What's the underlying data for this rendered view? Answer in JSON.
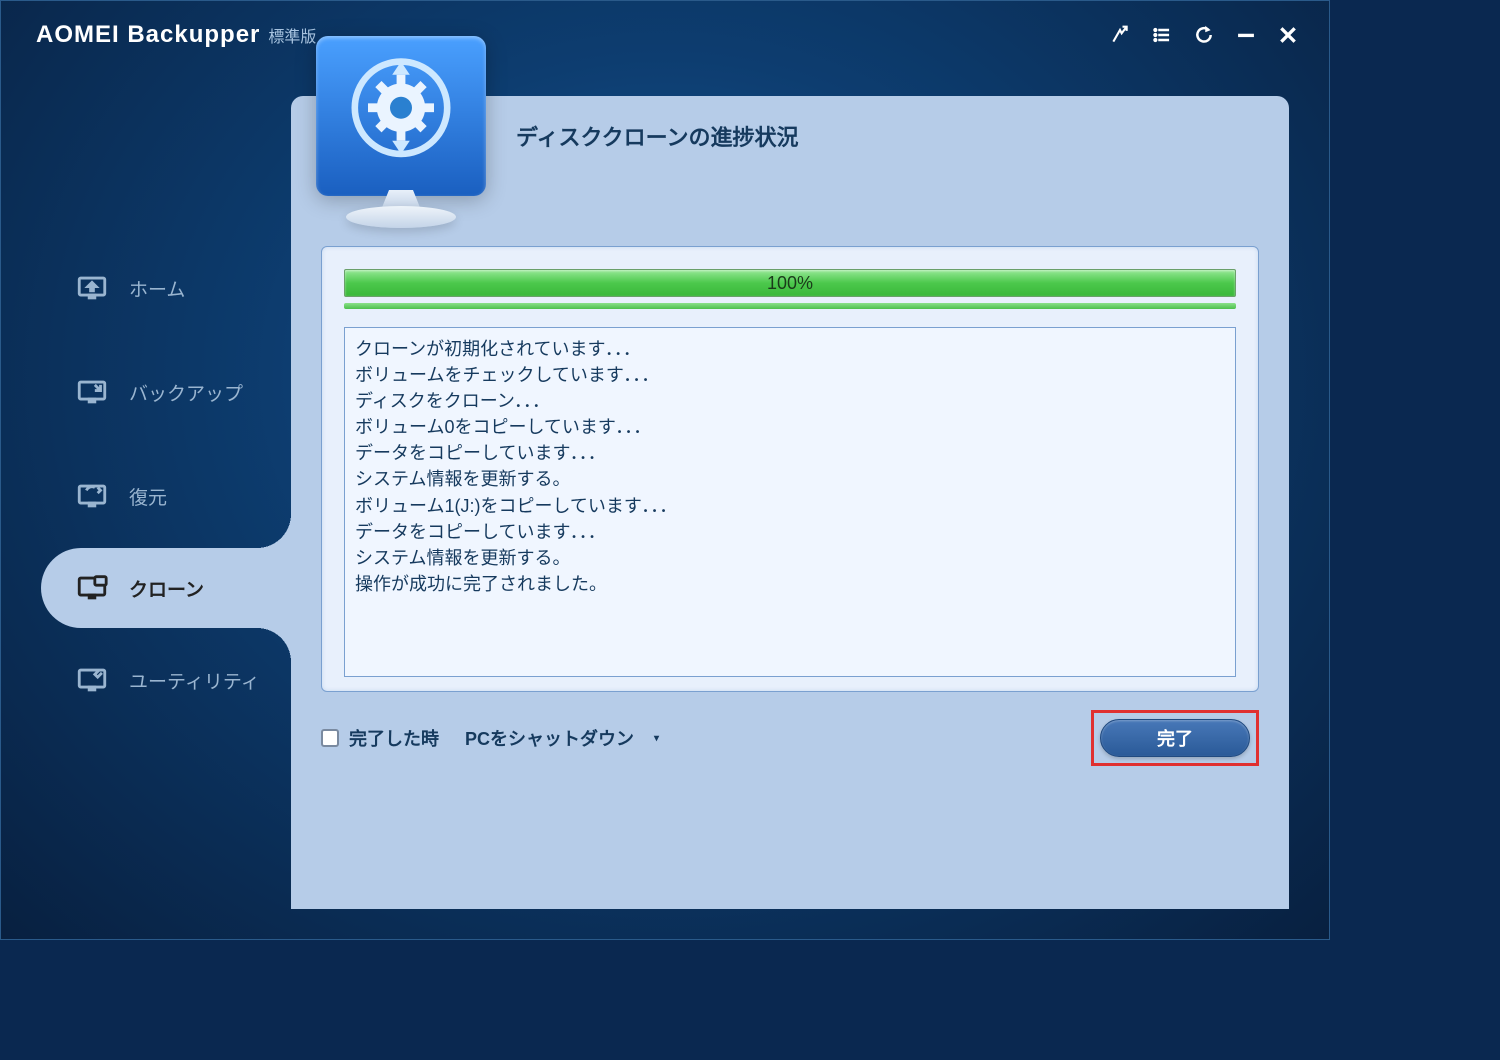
{
  "header": {
    "app_name": "AOMEI Backupper",
    "edition": "標準版"
  },
  "sidebar": {
    "items": [
      {
        "label": "ホーム"
      },
      {
        "label": "バックアップ"
      },
      {
        "label": "復元"
      },
      {
        "label": "クローン"
      },
      {
        "label": "ユーティリティ"
      }
    ]
  },
  "main": {
    "title": "ディスククローンの進捗状況",
    "progress_text": "100%",
    "log": [
      "クローンが初期化されています．．．",
      "ボリュームをチェックしています．．．",
      "ディスクをクローン．．．",
      "ボリューム0をコピーしています．．．",
      "データをコピーしています．．．",
      "システム情報を更新する。",
      "ボリューム1(J:)をコピーしています．．．",
      "データをコピーしています．．．",
      "システム情報を更新する。",
      "操作が成功に完了されました。"
    ],
    "footer": {
      "checkbox_prefix": "完了した時",
      "dropdown_label": "PCをシャットダウン",
      "finish_button": "完了"
    }
  }
}
